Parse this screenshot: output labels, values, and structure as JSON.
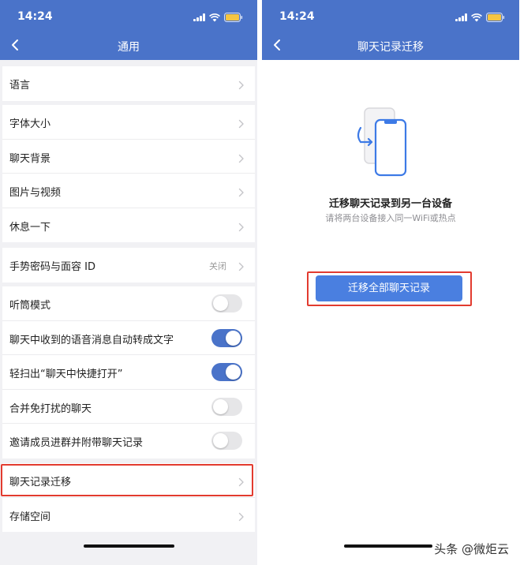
{
  "left": {
    "status_time": "14:24",
    "title": "通用",
    "groups": [
      [
        {
          "label": "语言"
        }
      ],
      [
        {
          "label": "字体大小"
        },
        {
          "label": "聊天背景"
        },
        {
          "label": "图片与视频"
        },
        {
          "label": "休息一下"
        }
      ],
      [
        {
          "label": "手势密码与面容 ID",
          "value": "关闭"
        }
      ],
      [
        {
          "label": "听筒模式",
          "toggle": false
        },
        {
          "label": "聊天中收到的语音消息自动转成文字",
          "toggle": true
        },
        {
          "label": "轻扫出“聊天中快捷打开”",
          "toggle": true
        },
        {
          "label": "合并免打扰的聊天",
          "toggle": false
        },
        {
          "label": "邀请成员进群并附带聊天记录",
          "toggle": false
        }
      ],
      [
        {
          "label": "聊天记录迁移",
          "highlighted": true
        },
        {
          "label": "存储空间"
        }
      ]
    ]
  },
  "right": {
    "status_time": "14:24",
    "title": "聊天记录迁移",
    "heading": "迁移聊天记录到另一台设备",
    "subheading": "请将两台设备接入同一WiFi或热点",
    "button_label": "迁移全部聊天记录"
  },
  "watermark": "头条 @微炬云",
  "colors": {
    "nav_blue": "#4a73c9",
    "button_blue": "#4a7fe0",
    "highlight_red": "#e23b2f",
    "page_bg": "#f1f1f4"
  },
  "icons": [
    "back-arrow-icon",
    "chevron-right-icon",
    "signal-icon",
    "wifi-icon",
    "battery-icon",
    "phone-migrate-icon"
  ]
}
